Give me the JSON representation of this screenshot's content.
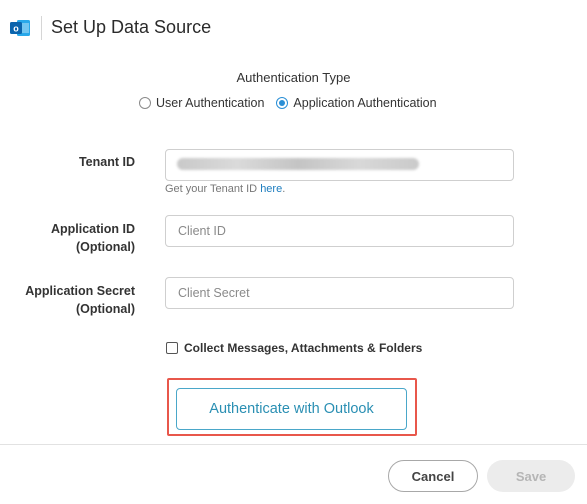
{
  "header": {
    "title": "Set Up Data Source",
    "icon": "outlook-icon",
    "icon_color": "#0a64ad"
  },
  "auth": {
    "label": "Authentication Type",
    "options": [
      {
        "label": "User Authentication",
        "selected": false
      },
      {
        "label": "Application Authentication",
        "selected": true
      }
    ],
    "accent_color": "#2a8fd6"
  },
  "fields": {
    "tenant": {
      "label": "Tenant ID",
      "help_prefix": "Get your Tenant ID ",
      "help_link": "here",
      "help_suffix": "."
    },
    "app_id": {
      "label_line1": "Application ID",
      "label_line2": "(Optional)",
      "placeholder": "Client ID"
    },
    "secret": {
      "label_line1": "Application Secret",
      "label_line2": "(Optional)",
      "placeholder": "Client Secret"
    }
  },
  "collect": {
    "label": "Collect Messages, Attachments & Folders",
    "checked": false
  },
  "authenticate_button": {
    "label": "Authenticate with Outlook",
    "highlight_color": "#e8574b"
  },
  "footer": {
    "cancel": "Cancel",
    "save": "Save",
    "save_enabled": false
  }
}
